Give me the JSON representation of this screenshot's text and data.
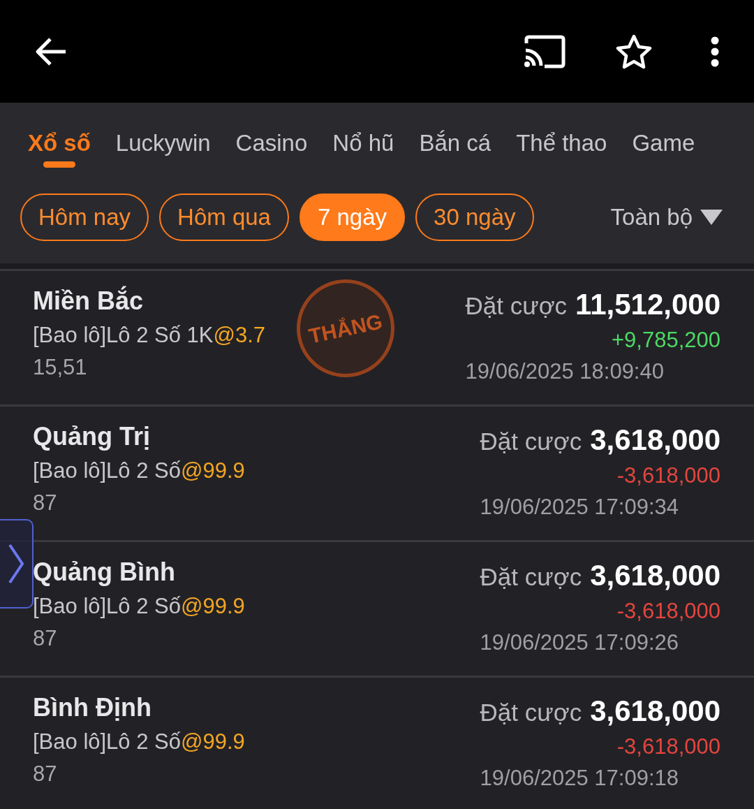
{
  "categories": [
    {
      "label": "Xổ số",
      "selected": true
    },
    {
      "label": "Luckywin",
      "selected": false
    },
    {
      "label": "Casino",
      "selected": false
    },
    {
      "label": "Nổ hũ",
      "selected": false
    },
    {
      "label": "Bắn cá",
      "selected": false
    },
    {
      "label": "Thể thao",
      "selected": false
    },
    {
      "label": "Game",
      "selected": false
    }
  ],
  "periods": [
    {
      "label": "Hôm nay",
      "selected": false
    },
    {
      "label": "Hôm qua",
      "selected": false
    },
    {
      "label": "7 ngày",
      "selected": true
    },
    {
      "label": "30 ngày",
      "selected": false
    }
  ],
  "filter": {
    "label": "Toàn bộ"
  },
  "bets": [
    {
      "title": "Miền Bắc",
      "bet": "[Bao lô]Lô 2 Số 1K",
      "odds": "@3.7",
      "numbers": "15,51",
      "stake_label": "Đặt cược",
      "stake": "11,512,000",
      "color": "#4cd964",
      "payout": "+9,785,200",
      "time": "19/06/2025 18:09:40",
      "stamp": "THẮNG"
    },
    {
      "title": "Quảng Trị",
      "bet": "[Bao lô]Lô 2 Số",
      "odds": "@99.9",
      "numbers": "87",
      "stake_label": "Đặt cược",
      "stake": "3,618,000",
      "color": "#e5453e",
      "payout": "-3,618,000",
      "time": "19/06/2025 17:09:34"
    },
    {
      "title": "Quảng Bình",
      "bet": "[Bao lô]Lô 2 Số",
      "odds": "@99.9",
      "numbers": "87",
      "stake_label": "Đặt cược",
      "stake": "3,618,000",
      "color": "#e5453e",
      "payout": "-3,618,000",
      "time": "19/06/2025 17:09:26"
    },
    {
      "title": "Bình Định",
      "bet": "[Bao lô]Lô 2 Số",
      "odds": "@99.9",
      "numbers": "87",
      "stake_label": "Đặt cược",
      "stake": "3,618,000",
      "color": "#e5453e",
      "payout": "-3,618,000",
      "time": "19/06/2025 17:09:18"
    }
  ]
}
